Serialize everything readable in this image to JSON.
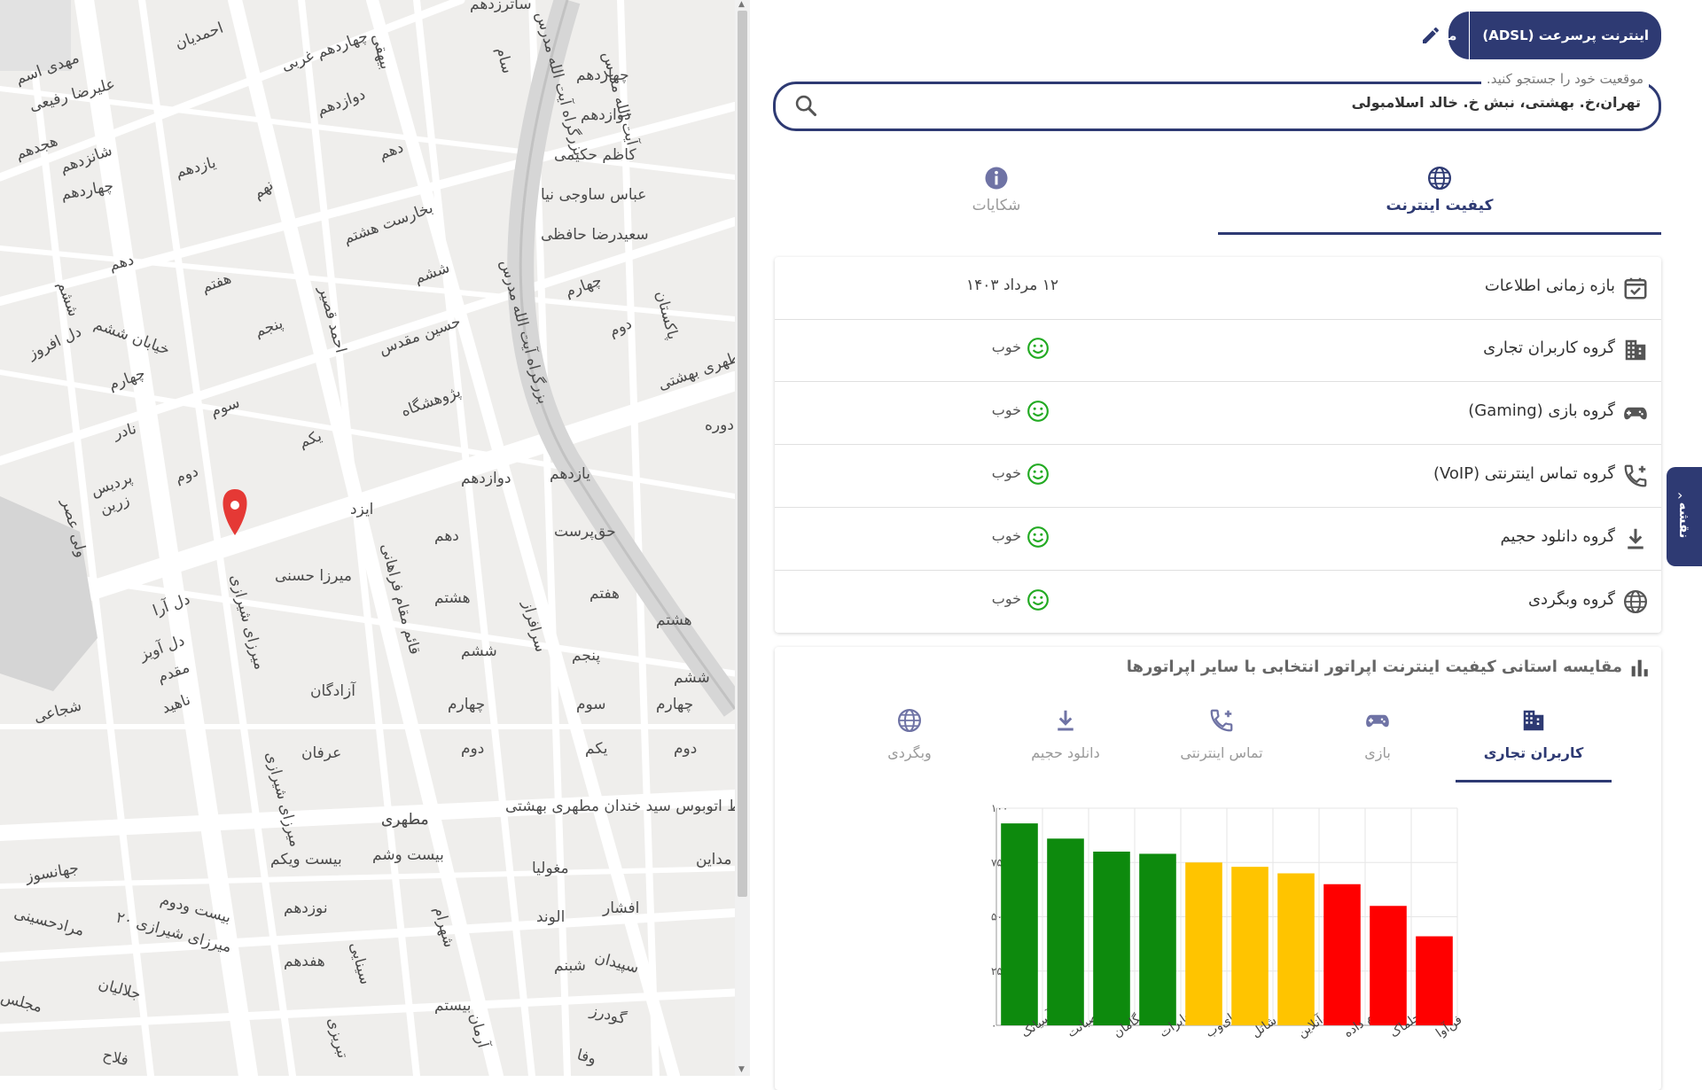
{
  "map": {
    "labels": [
      {
        "t": "احمدیان"
      },
      {
        "t": "مهدی اسم"
      },
      {
        "t": "علیرضا رفیعی"
      },
      {
        "t": "هجدهم"
      },
      {
        "t": "شانزدهم"
      },
      {
        "t": "چهاردهم"
      },
      {
        "t": "دهم"
      },
      {
        "t": "ششم"
      },
      {
        "t": "خیابان ششم"
      },
      {
        "t": "دل افروز"
      },
      {
        "t": "چهارم"
      },
      {
        "t": "نادر"
      },
      {
        "t": "پردیس"
      },
      {
        "t": "زرین"
      },
      {
        "t": "ولی عصر"
      },
      {
        "t": "دوم"
      },
      {
        "t": "سوم"
      },
      {
        "t": "پنجم"
      },
      {
        "t": "هفتم"
      },
      {
        "t": "نهم"
      },
      {
        "t": "یازدهم"
      },
      {
        "t": "چهاردهم غربی"
      },
      {
        "t": "دوازدهم"
      },
      {
        "t": "دهم"
      },
      {
        "t": "بخارست هشتم"
      },
      {
        "t": "ششم"
      },
      {
        "t": "احمد قصیر"
      },
      {
        "t": "حسین مقدس"
      },
      {
        "t": "پژوهشگاه"
      },
      {
        "t": "یکم"
      },
      {
        "t": "ایزد"
      },
      {
        "t": "میرزا حسنی"
      },
      {
        "t": "دل آرا"
      },
      {
        "t": "دل آویز"
      },
      {
        "t": "مقدم"
      },
      {
        "t": "ناهید"
      },
      {
        "t": "شجاعی"
      },
      {
        "t": "آزادگان"
      },
      {
        "t": "عرفان"
      },
      {
        "t": "میرزای شیرازی"
      },
      {
        "t": "میرزای شیرازی"
      },
      {
        "t": "مطهری"
      },
      {
        "t": "بیست ویکم"
      },
      {
        "t": "بیست وشم"
      },
      {
        "t": "جهانسوز"
      },
      {
        "t": "بیست ودوم"
      },
      {
        "t": "میرزای شیرازی ۲۰"
      },
      {
        "t": "مرادحسینی"
      },
      {
        "t": "نوزدهم"
      },
      {
        "t": "هفدهم"
      },
      {
        "t": "جلالیان"
      },
      {
        "t": "فلاح"
      },
      {
        "t": "مجلس"
      },
      {
        "t": "سینایی"
      },
      {
        "t": "تبریزی"
      },
      {
        "t": "بیستم"
      },
      {
        "t": "آرمان"
      },
      {
        "t": "شهرام"
      },
      {
        "t": "قائم مقام فراهانی"
      },
      {
        "t": "دوازدهم"
      },
      {
        "t": "دهم"
      },
      {
        "t": "هشتم"
      },
      {
        "t": "ششم"
      },
      {
        "t": "چهارم"
      },
      {
        "t": "دوم"
      },
      {
        "t": "یازدهم"
      },
      {
        "t": "حق‌پرست"
      },
      {
        "t": "هفتم"
      },
      {
        "t": "پنجم"
      },
      {
        "t": "سوم"
      },
      {
        "t": "یکم"
      },
      {
        "t": "سرافراز"
      },
      {
        "t": "هشتم"
      },
      {
        "t": "ششم"
      },
      {
        "t": "چهارم"
      },
      {
        "t": "دوم"
      },
      {
        "t": "مطهری"
      },
      {
        "t": "خط اتوبوس سید خندان مطهری بهشتی"
      },
      {
        "t": "مداین"
      },
      {
        "t": "مغولیا"
      },
      {
        "t": "الوند"
      },
      {
        "t": "افشار"
      },
      {
        "t": "شبنم"
      },
      {
        "t": "سپیدان"
      },
      {
        "t": "گودرز"
      },
      {
        "t": "وفا"
      },
      {
        "t": "سام"
      },
      {
        "t": "چهاردهم"
      },
      {
        "t": "دوازدهم"
      },
      {
        "t": "کاظم حکیمی"
      },
      {
        "t": "عباس ساوجی نیا"
      },
      {
        "t": "سعیدرضا حافظی"
      },
      {
        "t": "چهارم"
      },
      {
        "t": "دوم"
      },
      {
        "t": "پاکستان"
      },
      {
        "t": "مطهری بهشتی"
      },
      {
        "t": "ساترزدهم"
      },
      {
        "t": "بزرگراه آیت الله مدرس"
      },
      {
        "t": "بزرگراه آیت الله مدرس"
      },
      {
        "t": "بیهقی"
      },
      {
        "t": "آیت الله مدرس"
      },
      {
        "t": "دوره"
      }
    ]
  },
  "header": {
    "operator_service": "اینترنت پرسرعت (ADSL)",
    "operator_name": "مخابرات"
  },
  "search": {
    "label": "موقعیت خود را جستجو کنید.",
    "value": "تهران،خ. بهشتی، نبش خ. خالد اسلامبولی"
  },
  "tabs": [
    {
      "label": "کیفیت اینترنت",
      "icon": "globe-icon",
      "active": true
    },
    {
      "label": "شکایات",
      "icon": "info-icon",
      "active": false
    }
  ],
  "info": {
    "rows": [
      {
        "label": "بازه زمانی اطلاعات",
        "icon": "calendar-check-icon",
        "value": "۱۲ مرداد ۱۴۰۳"
      },
      {
        "label": "گروه کاربران تجاری",
        "icon": "building-icon",
        "status": "خوب"
      },
      {
        "label": "گروه بازی (Gaming)",
        "icon": "gamepad-icon",
        "status": "خوب"
      },
      {
        "label": "گروه تماس اینترنتی (VoIP)",
        "icon": "phone-plus-icon",
        "status": "خوب"
      },
      {
        "label": "گروه دانلود حجیم",
        "icon": "download-icon",
        "status": "خوب"
      },
      {
        "label": "گروه وبگردی",
        "icon": "globe-icon",
        "status": "خوب"
      }
    ]
  },
  "compare": {
    "title": "مقایسه استانی کیفیت اینترنت اپراتور انتخابی با سایر اپراتورها",
    "tabs": [
      {
        "label": "کاربران تجاری",
        "icon": "building-icon",
        "active": true
      },
      {
        "label": "بازی",
        "icon": "gamepad-icon",
        "active": false
      },
      {
        "label": "تماس اینترنتی",
        "icon": "phone-plus-icon",
        "active": false
      },
      {
        "label": "دانلود حجیم",
        "icon": "download-icon",
        "active": false
      },
      {
        "label": "وبگردی",
        "icon": "globe-icon",
        "active": false
      }
    ]
  },
  "chart_data": {
    "type": "bar",
    "categories": [
      "آسیاتک",
      "صبانت",
      "پیشگامان",
      "مخابرات",
      "های‌وب",
      "شاتل",
      "پارس‌آنلاین",
      "رهام داده",
      "حلماک",
      "فن‌آوا"
    ],
    "values": [
      93,
      86,
      80,
      79,
      75,
      73,
      70,
      65,
      55,
      41
    ],
    "colors": [
      "#0d8a0d",
      "#0d8a0d",
      "#0d8a0d",
      "#0d8a0d",
      "#ffc400",
      "#ffc400",
      "#ffc400",
      "#ff0000",
      "#ff0000",
      "#ff0000"
    ],
    "yticks": [
      "۰",
      "۲۵",
      "۵۰",
      "۷۵",
      "۱۰۰"
    ],
    "ylim": [
      0,
      100
    ],
    "grid": true
  },
  "drawer": {
    "label": "نقشه"
  },
  "colors": {
    "primary": "#2e3a73",
    "good": "#22aa22"
  }
}
